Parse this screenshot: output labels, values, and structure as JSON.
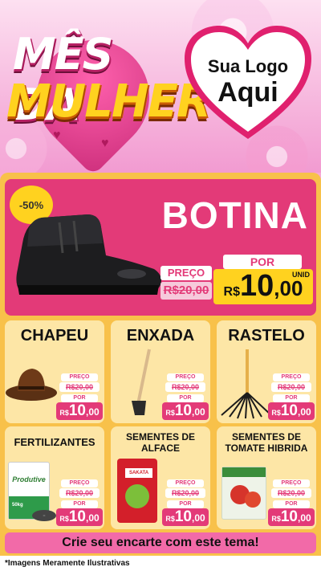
{
  "header": {
    "title_line1": "MÊS DA",
    "title_line2": "MULHER",
    "logo_line1": "Sua Logo",
    "logo_line2": "Aqui"
  },
  "hero": {
    "discount": "-50%",
    "title": "BOTINA",
    "preco_label": "PREÇO",
    "old_price": "R$20,00",
    "por_label": "POR",
    "new_currency": "R$",
    "new_int": "10",
    "new_dec": ",00",
    "unit": "UNID"
  },
  "products": [
    {
      "title": "CHAPEU",
      "preco_label": "PREÇO",
      "old_price": "R$20,00",
      "por_label": "POR",
      "currency": "R$",
      "int": "10",
      "dec": ",00",
      "icon": "hat-icon"
    },
    {
      "title": "ENXADA",
      "preco_label": "PREÇO",
      "old_price": "R$20,00",
      "por_label": "POR",
      "currency": "R$",
      "int": "10",
      "dec": ",00",
      "icon": "hoe-icon"
    },
    {
      "title": "RASTELO",
      "preco_label": "PREÇO",
      "old_price": "R$20,00",
      "por_label": "POR",
      "currency": "R$",
      "int": "10",
      "dec": ",00",
      "icon": "rake-icon"
    },
    {
      "title": "FERTILIZANTES",
      "preco_label": "PREÇO",
      "old_price": "R$20,00",
      "por_label": "POR",
      "currency": "R$",
      "int": "10",
      "dec": ",00",
      "icon": "fertilizer-bag-icon",
      "pkg_brand": "Produtive",
      "pkg_weight": "50kg"
    },
    {
      "title_l1": "SEMENTES DE",
      "title_l2": "ALFACE",
      "preco_label": "PREÇO",
      "old_price": "R$20,00",
      "por_label": "POR",
      "currency": "R$",
      "int": "10",
      "dec": ",00",
      "icon": "seed-packet-icon",
      "pkg_brand": "SAKATA"
    },
    {
      "title_l1": "SEMENTES DE",
      "title_l2": "TOMATE HIBRIDA",
      "preco_label": "PREÇO",
      "old_price": "R$20,00",
      "por_label": "POR",
      "currency": "R$",
      "int": "10",
      "dec": ",00",
      "icon": "tomato-seed-packet-icon"
    }
  ],
  "cta": "Crie seu encarte com este tema!",
  "footer": "*Imagens Meramente Ilustrativas",
  "colors": {
    "pink": "#e33a78",
    "yellow": "#ffd21f",
    "card": "#fde6a6",
    "panel": "#f8c14a"
  }
}
